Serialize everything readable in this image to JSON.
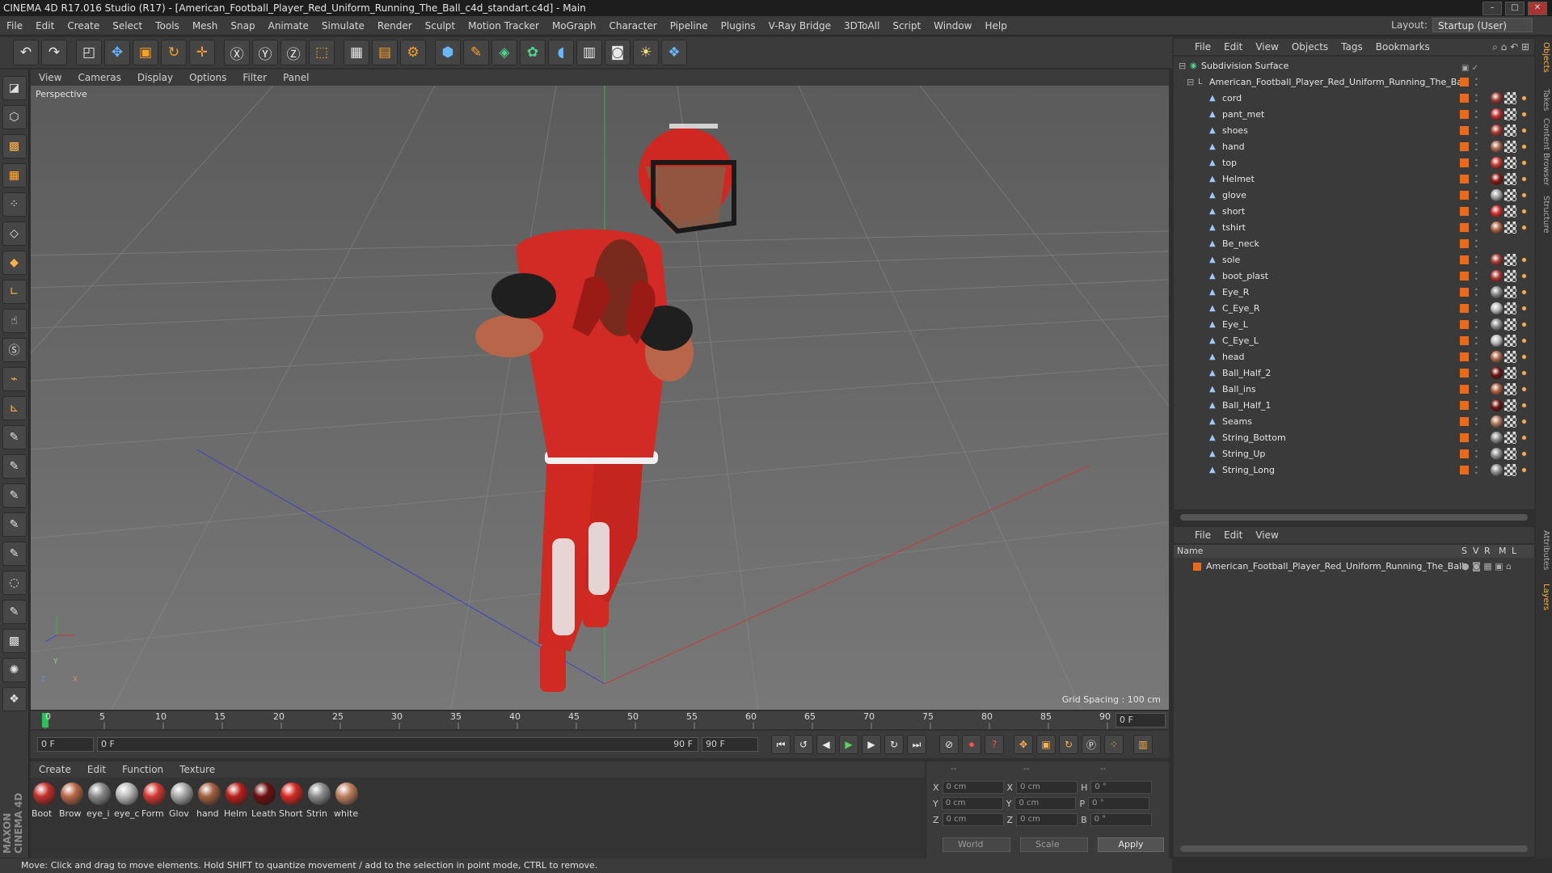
{
  "window": {
    "title": "CINEMA 4D R17.016 Studio (R17) - [American_Football_Player_Red_Uniform_Running_The_Ball_c4d_standart.c4d] - Main"
  },
  "menubar": {
    "items": [
      "File",
      "Edit",
      "Create",
      "Select",
      "Tools",
      "Mesh",
      "Snap",
      "Animate",
      "Simulate",
      "Render",
      "Sculpt",
      "Motion Tracker",
      "MoGraph",
      "Character",
      "Pipeline",
      "Plugins",
      "V-Ray Bridge",
      "3DToAll",
      "Script",
      "Window",
      "Help"
    ],
    "layout_label": "Layout:",
    "layout_value": "Startup (User)"
  },
  "viewport": {
    "menu": [
      "View",
      "Cameras",
      "Display",
      "Options",
      "Filter",
      "Panel"
    ],
    "camera_label": "Perspective",
    "grid_spacing": "Grid Spacing : 100 cm",
    "axis": {
      "x": "X",
      "y": "Y",
      "z": "Z"
    }
  },
  "timeline": {
    "ticks": [
      "0",
      "5",
      "10",
      "15",
      "20",
      "25",
      "30",
      "35",
      "40",
      "45",
      "50",
      "55",
      "60",
      "65",
      "70",
      "75",
      "80",
      "85",
      "90"
    ],
    "current_frame": "0 F",
    "start_field": "0 F",
    "range_start": "0 F",
    "range_end": "90 F",
    "end_field": "90 F"
  },
  "materials": {
    "menu": [
      "Create",
      "Edit",
      "Function",
      "Texture"
    ],
    "items": [
      {
        "label": "Boot",
        "color": "#c2302a"
      },
      {
        "label": "Brow",
        "color": "#b86a4a"
      },
      {
        "label": "eye_i",
        "color": "#8b8b8b"
      },
      {
        "label": "eye_c",
        "color": "#bcbcbc"
      },
      {
        "label": "Form",
        "color": "#d23a34"
      },
      {
        "label": "Glov",
        "color": "#a8a8a8"
      },
      {
        "label": "hand",
        "color": "#a26040"
      },
      {
        "label": "Helm",
        "color": "#b8201c"
      },
      {
        "label": "Leath",
        "color": "#6e1010"
      },
      {
        "label": "Short",
        "color": "#d42a22"
      },
      {
        "label": "Strin",
        "color": "#8e8e8e"
      },
      {
        "label": "white",
        "color": "#c08060"
      }
    ],
    "brand": "MAXON CINEMA 4D"
  },
  "attributes": {
    "header": [
      "--",
      "--",
      "--"
    ],
    "rows": [
      {
        "a": "X",
        "av": "0 cm",
        "b": "X",
        "bv": "0 cm",
        "c": "H",
        "cv": "0 °"
      },
      {
        "a": "Y",
        "av": "0 cm",
        "b": "Y",
        "bv": "0 cm",
        "c": "P",
        "cv": "0 °"
      },
      {
        "a": "Z",
        "av": "0 cm",
        "b": "Z",
        "bv": "0 cm",
        "c": "B",
        "cv": "0 °"
      }
    ],
    "coord_system": "World",
    "mode": "Scale",
    "apply": "Apply"
  },
  "status": {
    "text": "Move: Click and drag to move elements. Hold SHIFT to quantize movement / add to the selection in point mode, CTRL to remove."
  },
  "object_manager": {
    "menu": [
      "File",
      "Edit",
      "View",
      "Objects",
      "Tags",
      "Bookmarks"
    ],
    "root": "Subdivision Surface",
    "group": "American_Football_Player_Red_Uniform_Running_The_Ball",
    "objects": [
      {
        "name": "cord",
        "tag": "#9a3a30"
      },
      {
        "name": "pant_met",
        "tag": "#c03030"
      },
      {
        "name": "shoes",
        "tag": "#a53a32"
      },
      {
        "name": "hand",
        "tag": "#a8684a"
      },
      {
        "name": "top",
        "tag": "#c83a30"
      },
      {
        "name": "Helmet",
        "tag": "#8a1a14"
      },
      {
        "name": "glove",
        "tag": "#a0a0a0"
      },
      {
        "name": "short",
        "tag": "#d4302a"
      },
      {
        "name": "tshirt",
        "tag": "#b06848"
      },
      {
        "name": "Be_neck",
        "tag": ""
      },
      {
        "name": "sole",
        "tag": "#a83a32"
      },
      {
        "name": "boot_plast",
        "tag": "#b03a32"
      },
      {
        "name": "Eye_R",
        "tag": "#8a8a8a"
      },
      {
        "name": "C_Eye_R",
        "tag": "#bcbcbc"
      },
      {
        "name": "Eye_L",
        "tag": "#8a8a8a"
      },
      {
        "name": "C_Eye_L",
        "tag": "#bcbcbc"
      },
      {
        "name": "head",
        "tag": "#a8684a"
      },
      {
        "name": "Ball_Half_2",
        "tag": "#6e1410"
      },
      {
        "name": "Ball_ins",
        "tag": "#b06040"
      },
      {
        "name": "Ball_Half_1",
        "tag": "#6e1410"
      },
      {
        "name": "Seams",
        "tag": "#b07a5a"
      },
      {
        "name": "String_Bottom",
        "tag": "#8e8e8e"
      },
      {
        "name": "String_Up",
        "tag": "#8e8e8e"
      },
      {
        "name": "String_Long",
        "tag": "#8e8e8e"
      }
    ]
  },
  "layer_manager": {
    "menu": [
      "File",
      "Edit",
      "View"
    ],
    "columns": {
      "name": "Name",
      "s": "S",
      "v": "V",
      "r": "R",
      "m": "M",
      "l": "L"
    },
    "layer": "American_Football_Player_Red_Uniform_Running_The_Ball"
  },
  "side_tabs": [
    "Objects",
    "Takes",
    "Content Browser",
    "Structure",
    "Attributes",
    "Layers"
  ]
}
